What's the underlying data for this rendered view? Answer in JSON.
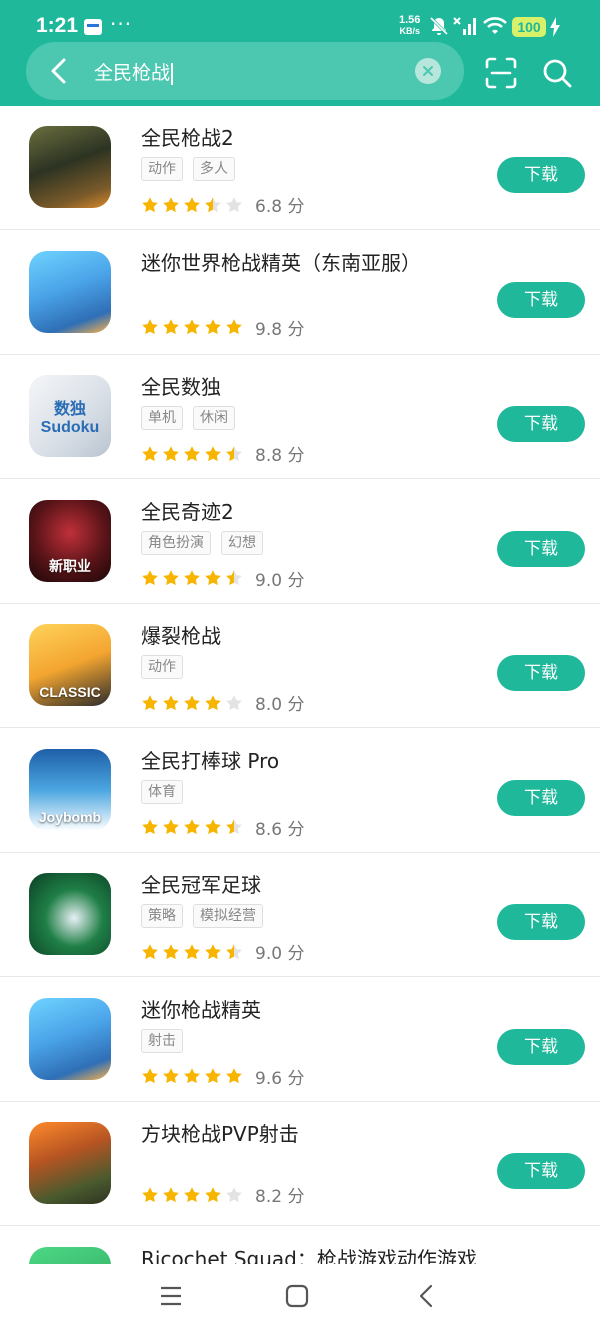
{
  "status_bar": {
    "time": "1:21",
    "dots": "···",
    "net_speed_value": "1.56",
    "net_speed_unit": "KB/s",
    "battery": "100",
    "icons": [
      "app-notification-icon",
      "mute-icon",
      "signal-icon",
      "wifi-icon",
      "charging-icon"
    ]
  },
  "search": {
    "query": "全民枪战",
    "icons": [
      "back-arrow-icon",
      "clear-icon",
      "scan-icon",
      "search-icon"
    ]
  },
  "download_label": "下载",
  "theme": {
    "accent": "#1fb89b",
    "star": "#f7b500",
    "star_empty": "#e3e3e3"
  },
  "apps": [
    {
      "name": "全民枪战2",
      "tags": [
        "动作",
        "多人"
      ],
      "rating": 3.5,
      "score": "6.8 分"
    },
    {
      "name": "迷你世界枪战精英（东南亚服）",
      "tags": [],
      "rating": 5,
      "score": "9.8 分"
    },
    {
      "name": "全民数独",
      "tags": [
        "单机",
        "休闲"
      ],
      "rating": 4.5,
      "score": "8.8 分",
      "icon_text": "数独 Sudoku"
    },
    {
      "name": "全民奇迹2",
      "tags": [
        "角色扮演",
        "幻想"
      ],
      "rating": 4.5,
      "score": "9.0 分",
      "icon_text": "新职业"
    },
    {
      "name": "爆裂枪战",
      "tags": [
        "动作"
      ],
      "rating": 4,
      "score": "8.0 分",
      "icon_text": "CLASSIC"
    },
    {
      "name": "全民打棒球 Pro",
      "tags": [
        "体育"
      ],
      "rating": 4.5,
      "score": "8.6 分",
      "icon_text": "Joybomb"
    },
    {
      "name": "全民冠军足球",
      "tags": [
        "策略",
        "模拟经营"
      ],
      "rating": 4.5,
      "score": "9.0 分"
    },
    {
      "name": "迷你枪战精英",
      "tags": [
        "射击"
      ],
      "rating": 5,
      "score": "9.6 分"
    },
    {
      "name": "方块枪战PVP射击",
      "tags": [],
      "rating": 4,
      "score": "8.2 分"
    },
    {
      "name": "Ricochet Squad：枪战游戏动作游戏",
      "tags": [],
      "rating": 0,
      "score": ""
    }
  ],
  "nav": {
    "icons": [
      "menu-icon",
      "home-icon",
      "back-icon"
    ]
  }
}
